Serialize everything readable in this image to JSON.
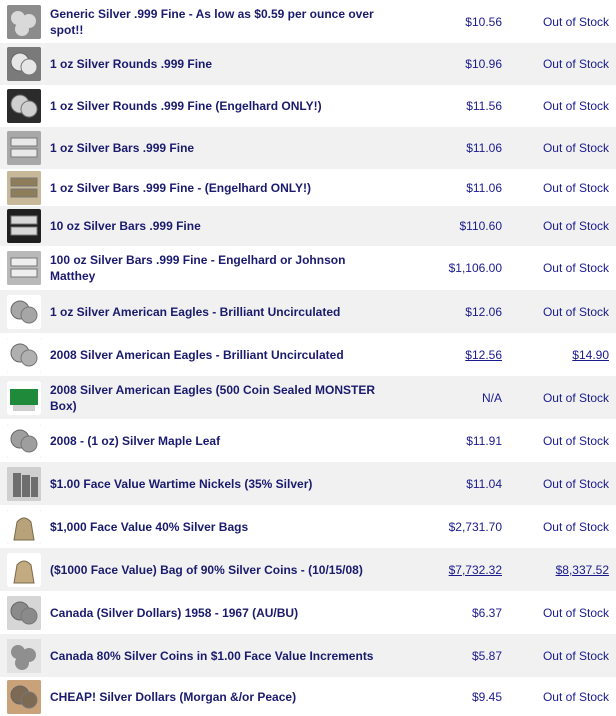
{
  "products": [
    {
      "name": "Generic Silver .999 Fine - As low as $0.59 per ounce over spot!!",
      "price": "$10.56",
      "stock": "Out of Stock",
      "icon": "silver-pile-icon",
      "price_link": false,
      "stock_link": false
    },
    {
      "name": "1 oz Silver Rounds .999 Fine",
      "price": "$10.96",
      "stock": "Out of Stock",
      "icon": "silver-rounds-icon",
      "price_link": false,
      "stock_link": false
    },
    {
      "name": "1 oz Silver Rounds .999 Fine (Engelhard ONLY!)",
      "price": "$11.56",
      "stock": "Out of Stock",
      "icon": "engelhard-rounds-icon",
      "price_link": false,
      "stock_link": false
    },
    {
      "name": "1 oz Silver Bars .999 Fine",
      "price": "$11.06",
      "stock": "Out of Stock",
      "icon": "silver-bars-icon",
      "price_link": false,
      "stock_link": false
    },
    {
      "name": "1 oz Silver Bars .999 Fine - (Engelhard ONLY!)",
      "price": "$11.06",
      "stock": "Out of Stock",
      "icon": "engelhard-bars-icon",
      "price_link": false,
      "stock_link": false
    },
    {
      "name": "10 oz Silver Bars .999 Fine",
      "price": "$110.60",
      "stock": "Out of Stock",
      "icon": "ten-oz-bars-icon",
      "price_link": false,
      "stock_link": false
    },
    {
      "name": "100 oz Silver Bars .999 Fine - Engelhard or Johnson Matthey",
      "price": "$1,106.00",
      "stock": "Out of Stock",
      "icon": "hundred-oz-bars-icon",
      "price_link": false,
      "stock_link": false
    },
    {
      "name": "1 oz Silver American Eagles - Brilliant Uncirculated",
      "price": "$12.06",
      "stock": "Out of Stock",
      "icon": "american-eagle-icon",
      "price_link": false,
      "stock_link": false
    },
    {
      "name": "2008 Silver American Eagles - Brilliant Uncirculated",
      "price": "$12.56",
      "stock": "$14.90",
      "icon": "american-eagle-2008-icon",
      "price_link": true,
      "stock_link": true
    },
    {
      "name": "2008 Silver American Eagles (500 Coin Sealed MONSTER Box)",
      "price": "N/A",
      "stock": "Out of Stock",
      "icon": "monster-box-icon",
      "price_link": false,
      "stock_link": false
    },
    {
      "name": "2008 - (1 oz) Silver Maple Leaf",
      "price": "$11.91",
      "stock": "Out of Stock",
      "icon": "maple-leaf-icon",
      "price_link": false,
      "stock_link": false
    },
    {
      "name": "$1.00 Face Value Wartime Nickels (35% Silver)",
      "price": "$11.04",
      "stock": "Out of Stock",
      "icon": "nickels-stack-icon",
      "price_link": false,
      "stock_link": false
    },
    {
      "name": "$1,000 Face Value 40% Silver Bags",
      "price": "$2,731.70",
      "stock": "Out of Stock",
      "icon": "coin-bag-icon",
      "price_link": false,
      "stock_link": false
    },
    {
      "name": "($1000 Face Value) Bag of 90% Silver Coins - (10/15/08)",
      "price": "$7,732.32",
      "stock": "$8,337.52",
      "icon": "coin-bag-90-icon",
      "price_link": true,
      "stock_link": true
    },
    {
      "name": "Canada (Silver Dollars) 1958 - 1967 (AU/BU)",
      "price": "$6.37",
      "stock": "Out of Stock",
      "icon": "canada-dollars-icon",
      "price_link": false,
      "stock_link": false
    },
    {
      "name": "Canada 80% Silver Coins in $1.00 Face Value Increments",
      "price": "$5.87",
      "stock": "Out of Stock",
      "icon": "canada-coins-icon",
      "price_link": false,
      "stock_link": false
    },
    {
      "name": "CHEAP! Silver Dollars (Morgan &/or Peace)",
      "price": "$9.45",
      "stock": "Out of Stock",
      "icon": "silver-dollars-icon",
      "price_link": false,
      "stock_link": false
    }
  ]
}
